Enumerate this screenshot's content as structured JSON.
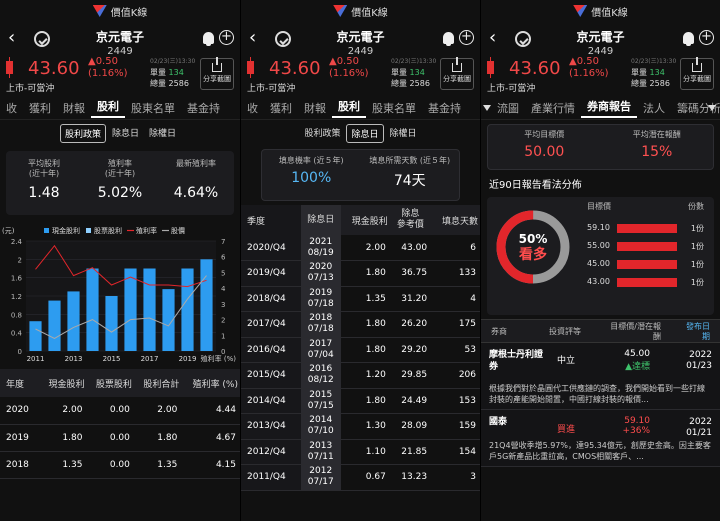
{
  "app_name": "價值K線",
  "stock": {
    "name": "京元電子",
    "code": "2449",
    "price": "43.60",
    "change": "▲0.50",
    "change_pct": "(1.16%)",
    "market": "上市-可當沖",
    "datetime": "02/23(三)13:30",
    "unit_vol_label": "單量",
    "unit_vol": "134",
    "total_vol_label": "總量",
    "total_vol": "2586",
    "share_label": "分享截圖"
  },
  "colors": {
    "up": "#f04848",
    "bar_blue": "#2d9cf0",
    "red_line": "#e2262b"
  },
  "screen1": {
    "tabs": [
      "收",
      "獲利",
      "財報",
      "股利",
      "股東名單",
      "基金持"
    ],
    "active_tab": 3,
    "segments": [
      "股利政策",
      "除息日",
      "除權日"
    ],
    "active_segment": 0,
    "kpis": [
      {
        "label": "平均股利",
        "label2": "(近十年)",
        "value": "1.48"
      },
      {
        "label": "殖利率",
        "label2": "(近十年)",
        "value": "5.02%"
      },
      {
        "label": "最新殖利率",
        "label2": "",
        "value": "4.64%"
      }
    ],
    "table": {
      "headers": [
        "年度",
        "現金股利",
        "股票股利",
        "股利合計",
        "殖利率 (%)"
      ],
      "rows": [
        [
          "2020",
          "2.00",
          "0.00",
          "2.00",
          "4.44"
        ],
        [
          "2019",
          "1.80",
          "0.00",
          "1.80",
          "4.67"
        ],
        [
          "2018",
          "1.35",
          "0.00",
          "1.35",
          "4.15"
        ]
      ]
    }
  },
  "chart_data": {
    "type": "bar",
    "title": "",
    "categories": [
      "2011",
      "2012",
      "2013",
      "2014",
      "2015",
      "2016",
      "2017",
      "2018",
      "2019",
      "2020"
    ],
    "x_tick_labels": [
      "2011",
      "2013",
      "2015",
      "2017",
      "2019"
    ],
    "series": [
      {
        "name": "現金股利",
        "type": "bar",
        "axis": "left",
        "values": [
          0.65,
          1.1,
          1.3,
          1.8,
          1.2,
          1.8,
          1.8,
          1.35,
          1.8,
          2.0
        ]
      },
      {
        "name": "股票股利",
        "type": "bar",
        "axis": "left",
        "values": [
          0,
          0,
          0,
          0,
          0,
          0,
          0,
          0,
          0,
          0
        ]
      },
      {
        "name": "殖利率",
        "type": "line",
        "axis": "right",
        "values": [
          5.2,
          6.7,
          4.8,
          5.3,
          4.2,
          4.7,
          4.2,
          4.2,
          4.1,
          4.5
        ]
      },
      {
        "name": "股價",
        "type": "line",
        "axis": "right",
        "values": [
          1.4,
          0.8,
          1.5,
          2.0,
          1.2,
          2.0,
          2.1,
          1.6,
          3.3,
          4.8
        ]
      }
    ],
    "ylabel_left": "(元)",
    "ylabel_right": "殖利率 (%)",
    "ylim_left": [
      0,
      2.4
    ],
    "ylim_right": [
      0,
      7
    ],
    "y_ticks_left": [
      "0",
      "0.4",
      "0.8",
      "1.2",
      "1.6",
      "2",
      "2.4"
    ],
    "y_ticks_right": [
      "0",
      "1",
      "2",
      "3",
      "4",
      "5",
      "6",
      "7"
    ],
    "legend_position": "top",
    "grid": true
  },
  "screen2": {
    "tabs": [
      "收",
      "獲利",
      "財報",
      "股利",
      "股東名單",
      "基金持"
    ],
    "active_tab": 3,
    "segments": [
      "股利政策",
      "除息日",
      "除權日"
    ],
    "active_segment": 1,
    "kpis": [
      {
        "label": "填息機率 (近５年)",
        "value": "100%"
      },
      {
        "label": "填息所需天數 (近５年)",
        "value": "74天"
      }
    ],
    "table": {
      "headers": [
        "季度",
        "除息日",
        "除息",
        "除息參考價",
        "填息天數"
      ],
      "header_sub": [
        "",
        "",
        "現金股利",
        "參考價",
        ""
      ],
      "rows": [
        [
          "2020/Q4",
          "2021",
          "08/19",
          "2.00",
          "43.00",
          "6"
        ],
        [
          "2019/Q4",
          "2020",
          "07/13",
          "1.80",
          "36.75",
          "133"
        ],
        [
          "2018/Q4",
          "2019",
          "07/18",
          "1.35",
          "31.20",
          "4"
        ],
        [
          "2017/Q4",
          "2018",
          "07/18",
          "1.80",
          "26.20",
          "175"
        ],
        [
          "2016/Q4",
          "2017",
          "07/04",
          "1.80",
          "29.20",
          "53"
        ],
        [
          "2015/Q4",
          "2016",
          "08/12",
          "1.20",
          "29.85",
          "206"
        ],
        [
          "2014/Q4",
          "2015",
          "07/15",
          "1.80",
          "24.49",
          "153"
        ],
        [
          "2013/Q4",
          "2014",
          "07/10",
          "1.30",
          "28.09",
          "159"
        ],
        [
          "2012/Q4",
          "2013",
          "07/11",
          "1.10",
          "21.85",
          "154"
        ],
        [
          "2011/Q4",
          "2012",
          "07/17",
          "0.67",
          "13.23",
          "3"
        ]
      ]
    }
  },
  "screen3": {
    "tabs": [
      "流圖",
      "產業行情",
      "券商報告",
      "法人",
      "籌碼分析"
    ],
    "active_tab": 2,
    "target": [
      {
        "label": "平均目標價",
        "value": "50.00"
      },
      {
        "label": "平均潛在報酬",
        "value": "15%"
      }
    ],
    "dist_title": "近90日報告看法分佈",
    "donut": {
      "pct": "50%",
      "label": "看多",
      "fraction": 0.5
    },
    "dist_head_price": "目標價",
    "dist_head_count": "份數",
    "dist_rows": [
      {
        "price": "59.10",
        "count": "1份"
      },
      {
        "price": "55.00",
        "count": "1份"
      },
      {
        "price": "45.00",
        "count": "1份"
      },
      {
        "price": "43.00",
        "count": "1份"
      }
    ],
    "report_head": {
      "broker": "券商",
      "rating": "投資評等",
      "tp": "目標價/潛在報酬",
      "date": "發布日期"
    },
    "reports": [
      {
        "broker": "摩根士丹利證券",
        "rating": "中立",
        "tp": "45.00",
        "tp_sub": "▲達標",
        "date_y": "2022",
        "date_md": "01/23",
        "summary": "根據我們對於晶圓代工供應鏈的調查，我們開始看到一些打線封裝的產能開始閒置，中國打線封裝的報價..."
      },
      {
        "broker": "國泰",
        "rating": "買進",
        "tp": "59.10",
        "tp_sub": "+36%",
        "date_y": "2022",
        "date_md": "01/21",
        "summary": "21Q4營收季增5.97%，達95.34億元，創歷史金高。因主要客戶5G新產品比重拉高，CMOS相關客戶、..."
      }
    ]
  }
}
